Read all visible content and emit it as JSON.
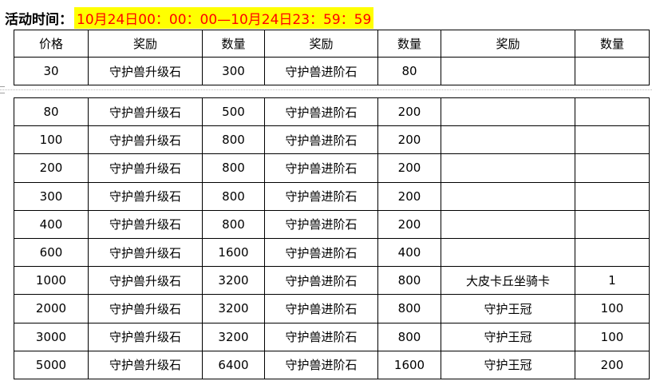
{
  "header": {
    "label": "活动时间：",
    "time_range": "10月24日00：00：00—10月24日23：59：59"
  },
  "table": {
    "columns": [
      "价格",
      "奖励",
      "数量",
      "奖励",
      "数量",
      "奖励",
      "数量"
    ],
    "rows_before_break": [
      [
        "30",
        "守护兽升级石",
        "300",
        "守护兽进阶石",
        "80",
        "",
        ""
      ]
    ],
    "rows_after_break": [
      [
        "80",
        "守护兽升级石",
        "500",
        "守护兽进阶石",
        "200",
        "",
        ""
      ],
      [
        "100",
        "守护兽升级石",
        "800",
        "守护兽进阶石",
        "200",
        "",
        ""
      ],
      [
        "200",
        "守护兽升级石",
        "800",
        "守护兽进阶石",
        "200",
        "",
        ""
      ],
      [
        "300",
        "守护兽升级石",
        "800",
        "守护兽进阶石",
        "200",
        "",
        ""
      ],
      [
        "400",
        "守护兽升级石",
        "800",
        "守护兽进阶石",
        "200",
        "",
        ""
      ],
      [
        "600",
        "守护兽升级石",
        "1600",
        "守护兽进阶石",
        "400",
        "",
        ""
      ],
      [
        "1000",
        "守护兽升级石",
        "3200",
        "守护兽进阶石",
        "800",
        "大皮卡丘坐骑卡",
        "1"
      ],
      [
        "2000",
        "守护兽升级石",
        "3200",
        "守护兽进阶石",
        "800",
        "守护王冠",
        "100"
      ],
      [
        "3000",
        "守护兽升级石",
        "3200",
        "守护兽进阶石",
        "800",
        "守护王冠",
        "100"
      ],
      [
        "5000",
        "守护兽升级石",
        "6400",
        "守护兽进阶石",
        "1600",
        "守护王冠",
        "200"
      ]
    ]
  },
  "colors": {
    "highlight_background": "#ffff00",
    "time_text": "#ff0000"
  }
}
